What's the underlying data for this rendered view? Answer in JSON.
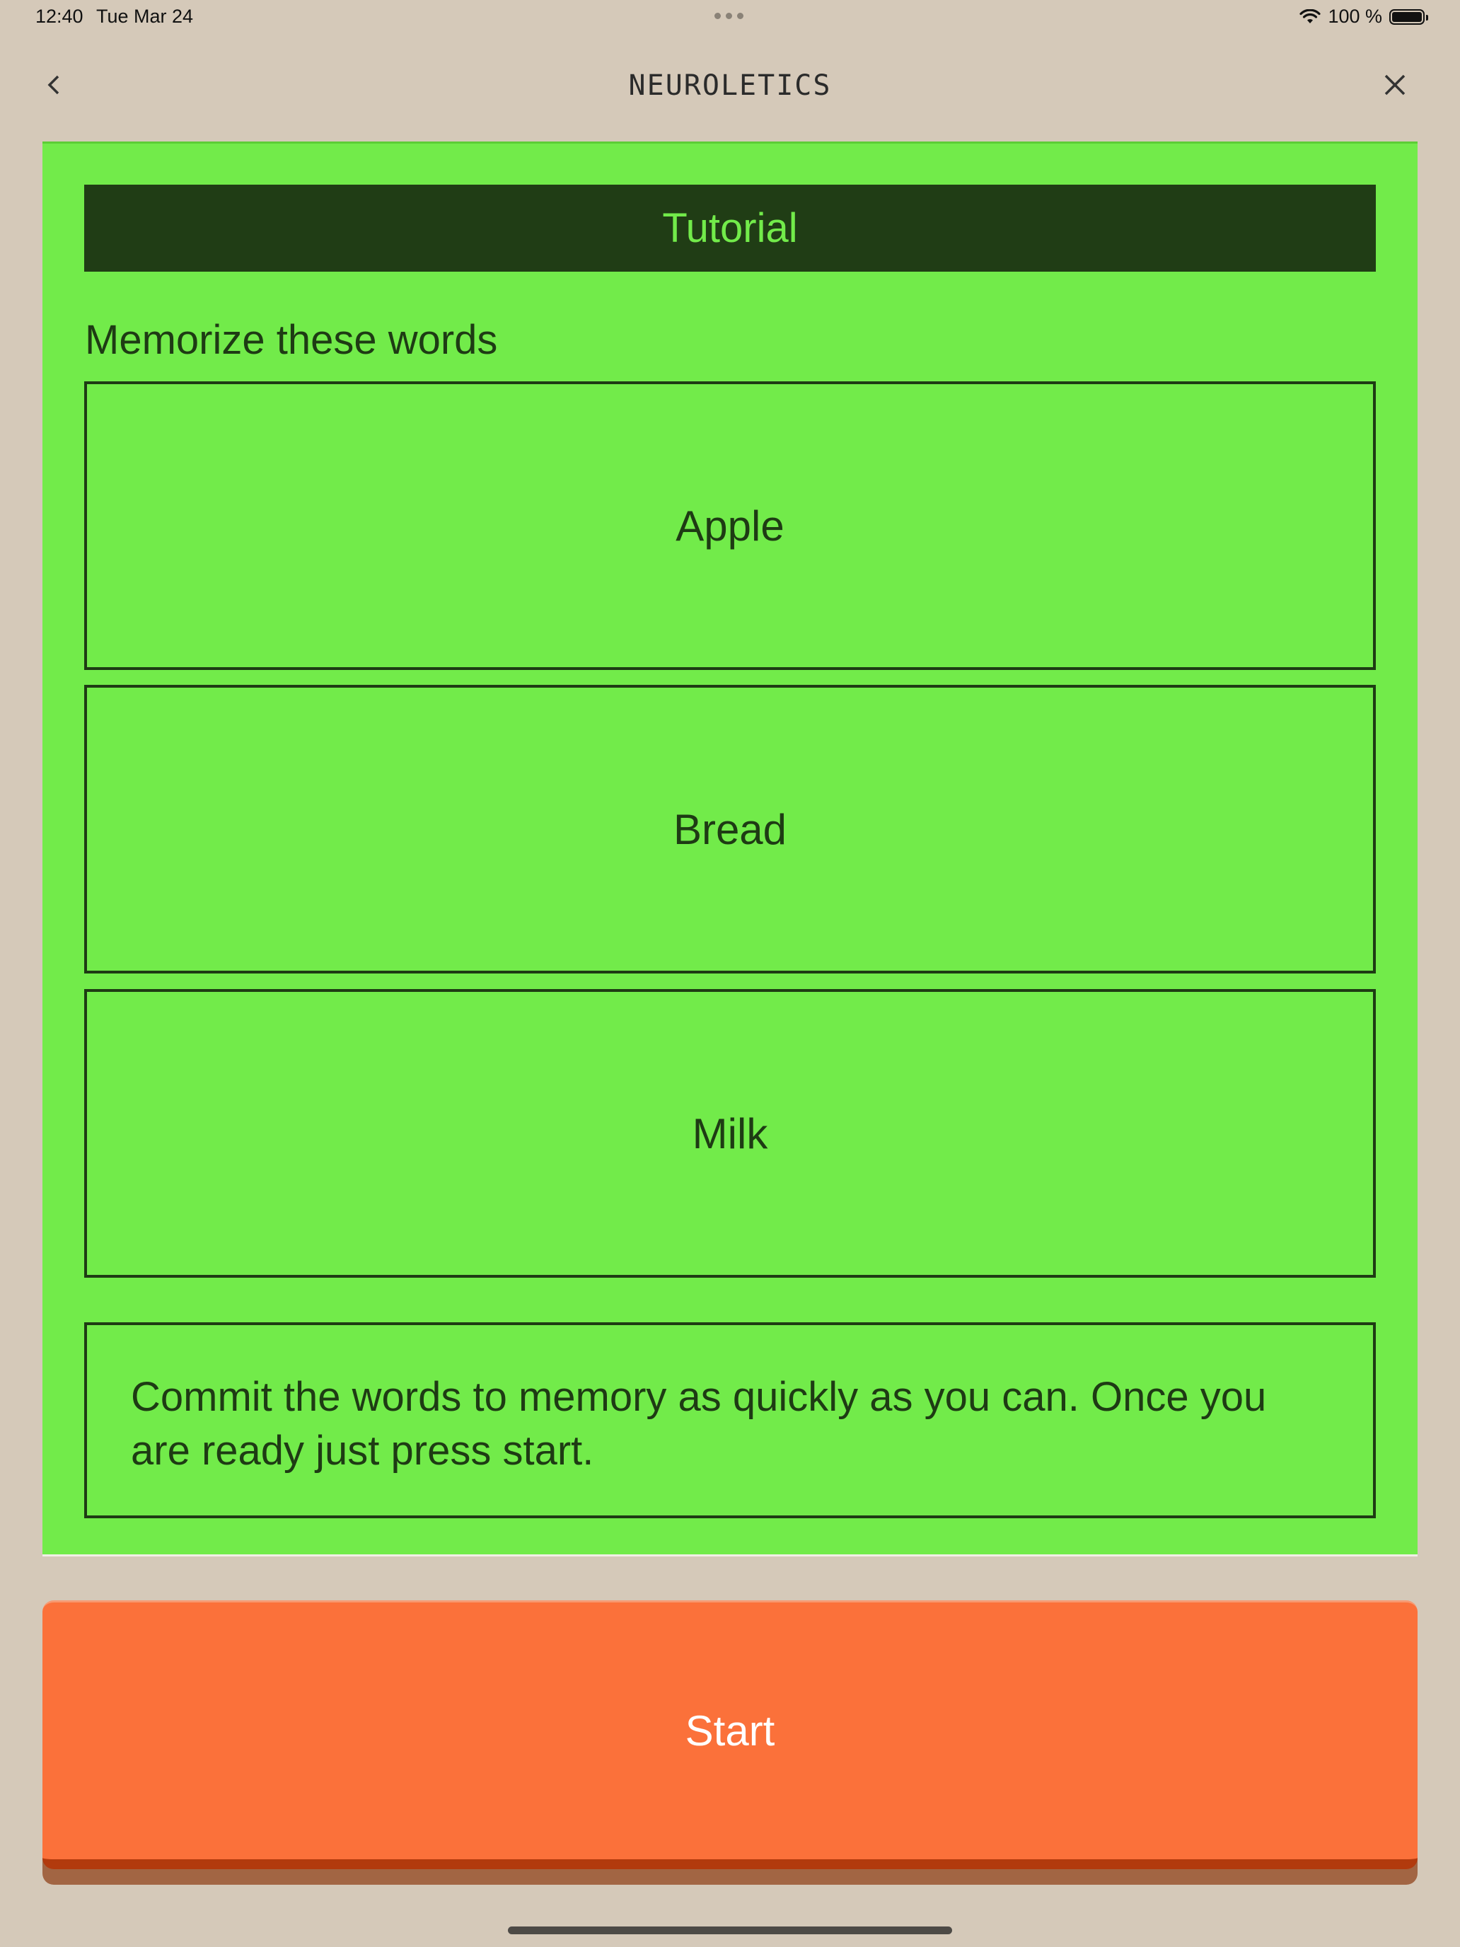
{
  "status_bar": {
    "time": "12:40",
    "date": "Tue Mar 24",
    "battery_text": "100 %",
    "battery_level": 1.0
  },
  "nav": {
    "title": "NEUROLETICS",
    "back_icon": "chevron-left-icon",
    "close_icon": "close-icon"
  },
  "tutorial": {
    "banner": "Tutorial",
    "heading": "Memorize these words",
    "words": [
      "Apple",
      "Bread",
      "Milk"
    ],
    "info": "Commit the words to memory as quickly as you can. Once you are ready just press start."
  },
  "start_button": {
    "label": "Start"
  },
  "colors": {
    "background": "#d5c9b9",
    "card_green": "#72eb4a",
    "dark_green": "#203d15",
    "accent_orange": "#fb713a"
  }
}
